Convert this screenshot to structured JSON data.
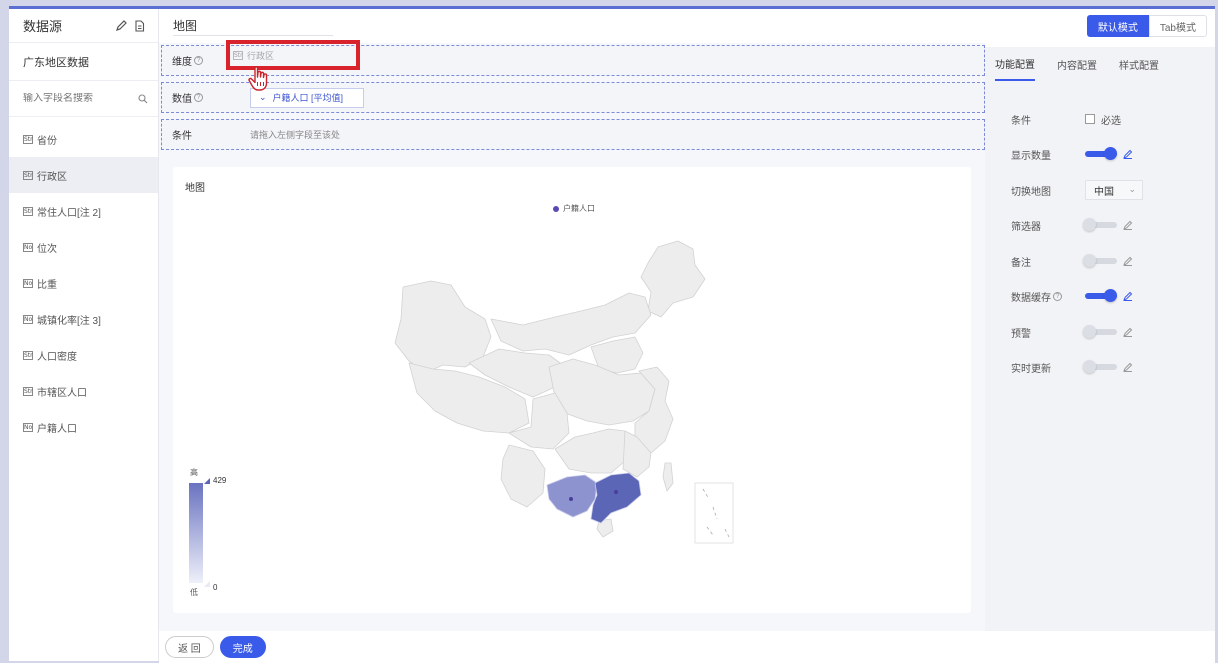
{
  "left": {
    "title": "数据源",
    "datasource": "广东地区数据",
    "search_placeholder": "输入字段名搜索",
    "fields": [
      {
        "type": "str",
        "label": "省份"
      },
      {
        "type": "str",
        "label": "行政区"
      },
      {
        "type": "str",
        "label": "常住人口[注 2]"
      },
      {
        "type": "num",
        "label": "位次"
      },
      {
        "type": "num",
        "label": "比重"
      },
      {
        "type": "num",
        "label": "城镇化率[注 3]"
      },
      {
        "type": "str",
        "label": "人口密度"
      },
      {
        "type": "str",
        "label": "市辖区人口"
      },
      {
        "type": "num",
        "label": "户籍人口"
      }
    ]
  },
  "center": {
    "chart_name": "地图",
    "slots": {
      "dimension": {
        "label": "维度",
        "dragging": "行政区",
        "help": "?"
      },
      "value": {
        "label": "数值",
        "pill": "户籍人口 [平均值]",
        "help": "?"
      },
      "condition": {
        "label": "条件",
        "hint": "请拖入左侧字段至该处"
      }
    },
    "card": {
      "title": "地图",
      "legend": "户籍人口",
      "visualmap": {
        "high": "高",
        "low": "低",
        "max": "429",
        "min": "0"
      }
    }
  },
  "right": {
    "modes": {
      "default": "默认模式",
      "tab": "Tab模式"
    },
    "tabs": [
      "功能配置",
      "内容配置",
      "样式配置"
    ],
    "rows": {
      "condition": {
        "label": "条件",
        "check_label": "必选"
      },
      "show_count": {
        "label": "显示数量",
        "on": true
      },
      "switch_map": {
        "label": "切换地图",
        "value": "中国"
      },
      "filter": {
        "label": "筛选器",
        "on": false
      },
      "note": {
        "label": "备注",
        "on": false
      },
      "cache": {
        "label": "数据缓存",
        "on": true
      },
      "alert": {
        "label": "预警",
        "on": false
      },
      "realtime": {
        "label": "实时更新",
        "on": false
      }
    }
  },
  "bottom": {
    "back": "返 回",
    "done": "完成"
  },
  "colors": {
    "accent": "#3a5bea",
    "highlight": "#d9232c",
    "map_high": "#5b66b6",
    "map_base": "#eeeeee"
  }
}
